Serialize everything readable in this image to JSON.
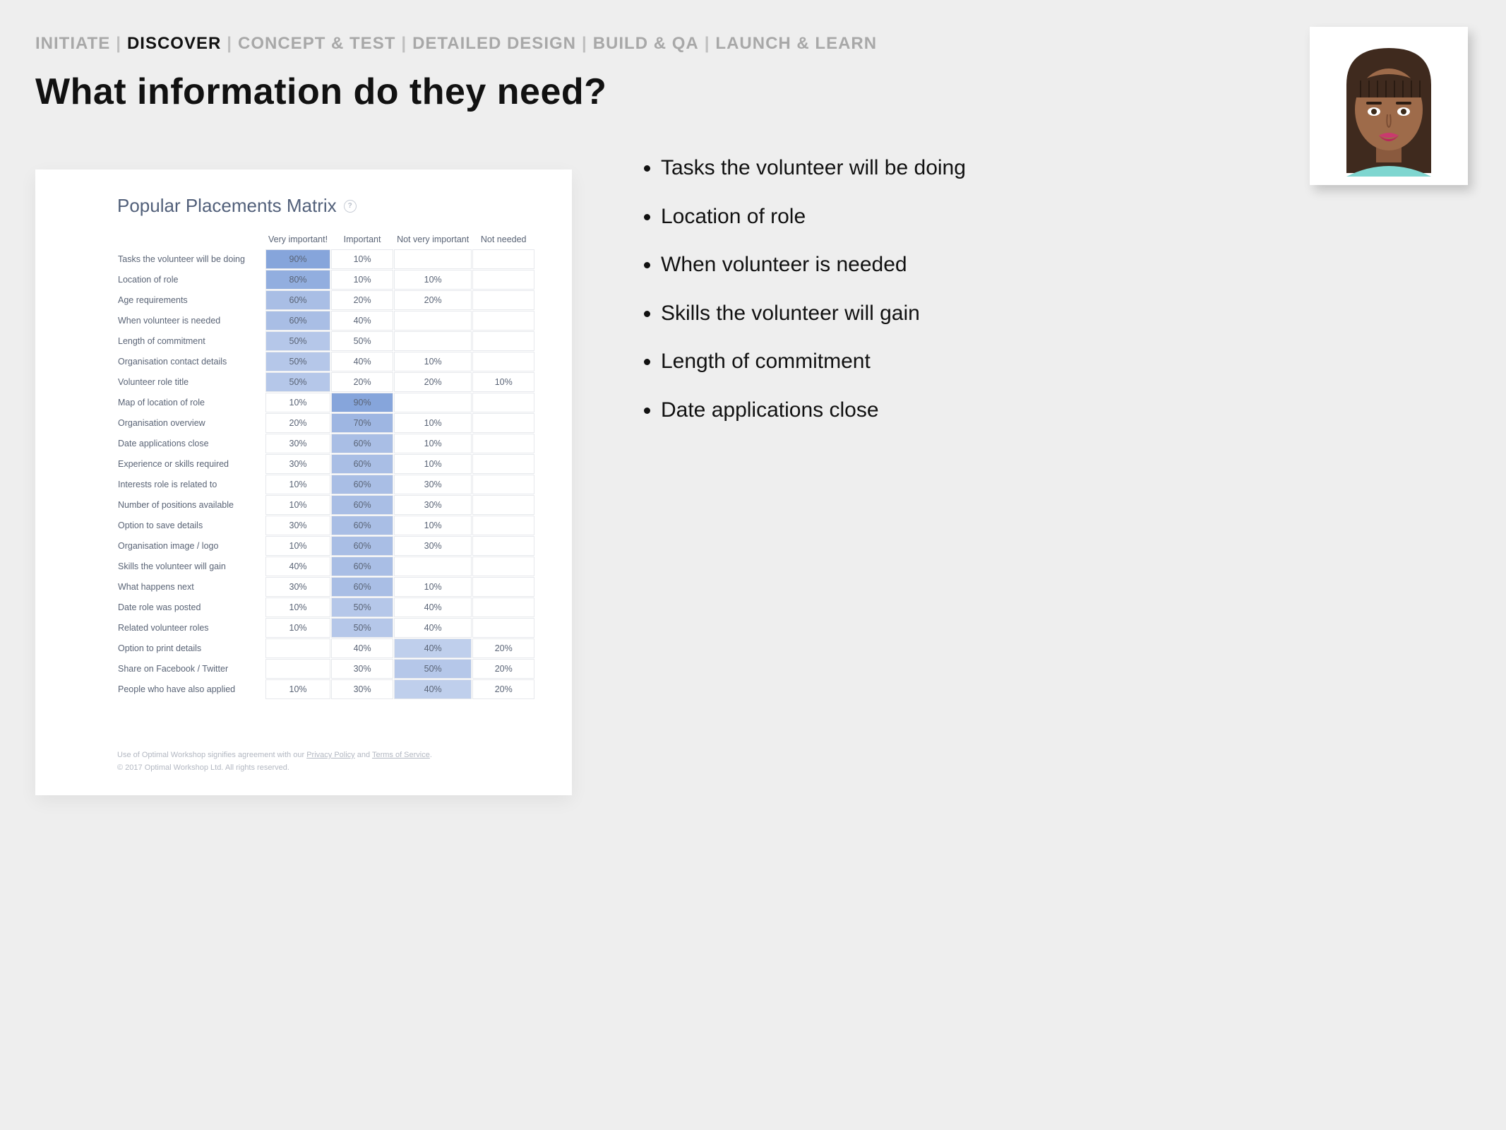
{
  "nav": {
    "items": [
      "INITIATE",
      "DISCOVER",
      "CONCEPT & TEST",
      "DETAILED DESIGN",
      "BUILD & QA",
      "LAUNCH & LEARN"
    ],
    "active_index": 1
  },
  "title": "What information do they need?",
  "matrix": {
    "title": "Popular Placements Matrix",
    "columns": [
      "Very important!",
      "Important",
      "Not very important",
      "Not needed"
    ],
    "rows": [
      {
        "label": "Tasks the volunteer will be doing",
        "cells": [
          "90%",
          "10%",
          "",
          ""
        ],
        "hi": 0
      },
      {
        "label": "Location of role",
        "cells": [
          "80%",
          "10%",
          "10%",
          ""
        ],
        "hi": 0
      },
      {
        "label": "Age requirements",
        "cells": [
          "60%",
          "20%",
          "20%",
          ""
        ],
        "hi": 0
      },
      {
        "label": "When volunteer is needed",
        "cells": [
          "60%",
          "40%",
          "",
          ""
        ],
        "hi": 0
      },
      {
        "label": "Length of commitment",
        "cells": [
          "50%",
          "50%",
          "",
          ""
        ],
        "hi": 0
      },
      {
        "label": "Organisation contact details",
        "cells": [
          "50%",
          "40%",
          "10%",
          ""
        ],
        "hi": 0
      },
      {
        "label": "Volunteer role title",
        "cells": [
          "50%",
          "20%",
          "20%",
          "10%"
        ],
        "hi": 0
      },
      {
        "label": "Map of location of role",
        "cells": [
          "10%",
          "90%",
          "",
          ""
        ],
        "hi": 1
      },
      {
        "label": "Organisation overview",
        "cells": [
          "20%",
          "70%",
          "10%",
          ""
        ],
        "hi": 1
      },
      {
        "label": "Date applications close",
        "cells": [
          "30%",
          "60%",
          "10%",
          ""
        ],
        "hi": 1
      },
      {
        "label": "Experience or skills required",
        "cells": [
          "30%",
          "60%",
          "10%",
          ""
        ],
        "hi": 1
      },
      {
        "label": "Interests role is related to",
        "cells": [
          "10%",
          "60%",
          "30%",
          ""
        ],
        "hi": 1
      },
      {
        "label": "Number of positions available",
        "cells": [
          "10%",
          "60%",
          "30%",
          ""
        ],
        "hi": 1
      },
      {
        "label": "Option to save details",
        "cells": [
          "30%",
          "60%",
          "10%",
          ""
        ],
        "hi": 1
      },
      {
        "label": "Organisation image / logo",
        "cells": [
          "10%",
          "60%",
          "30%",
          ""
        ],
        "hi": 1
      },
      {
        "label": "Skills the volunteer will gain",
        "cells": [
          "40%",
          "60%",
          "",
          ""
        ],
        "hi": 1
      },
      {
        "label": "What happens next",
        "cells": [
          "30%",
          "60%",
          "10%",
          ""
        ],
        "hi": 1
      },
      {
        "label": "Date role was posted",
        "cells": [
          "10%",
          "50%",
          "40%",
          ""
        ],
        "hi": 1
      },
      {
        "label": "Related volunteer roles",
        "cells": [
          "10%",
          "50%",
          "40%",
          ""
        ],
        "hi": 1
      },
      {
        "label": "Option to print details",
        "cells": [
          "",
          "40%",
          "40%",
          "20%"
        ],
        "hi": 2
      },
      {
        "label": "Share on Facebook / Twitter",
        "cells": [
          "",
          "30%",
          "50%",
          "20%"
        ],
        "hi": 2
      },
      {
        "label": "People who have also applied",
        "cells": [
          "10%",
          "30%",
          "40%",
          "20%"
        ],
        "hi": 2
      }
    ]
  },
  "footer": {
    "line1_pre": "Use of Optimal Workshop signifies agreement with our ",
    "privacy": "Privacy Policy",
    "and": " and ",
    "tos": "Terms of Service",
    "line1_post": ".",
    "line2": "© 2017 Optimal Workshop Ltd. All rights reserved."
  },
  "bullets": [
    "Tasks the volunteer will be doing",
    "Location of role",
    "When volunteer is needed",
    "Skills the volunteer will gain",
    "Length of commitment",
    "Date applications close"
  ],
  "chart_data": {
    "type": "table",
    "title": "Popular Placements Matrix",
    "columns": [
      "Very important!",
      "Important",
      "Not very important",
      "Not needed"
    ],
    "categories": [
      "Tasks the volunteer will be doing",
      "Location of role",
      "Age requirements",
      "When volunteer is needed",
      "Length of commitment",
      "Organisation contact details",
      "Volunteer role title",
      "Map of location of role",
      "Organisation overview",
      "Date applications close",
      "Experience or skills required",
      "Interests role is related to",
      "Number of positions available",
      "Option to save details",
      "Organisation image / logo",
      "Skills the volunteer will gain",
      "What happens next",
      "Date role was posted",
      "Related volunteer roles",
      "Option to print details",
      "Share on Facebook / Twitter",
      "People who have also applied"
    ],
    "series": [
      {
        "name": "Very important!",
        "values": [
          90,
          80,
          60,
          60,
          50,
          50,
          50,
          10,
          20,
          30,
          30,
          10,
          10,
          30,
          10,
          40,
          30,
          10,
          10,
          null,
          null,
          10
        ]
      },
      {
        "name": "Important",
        "values": [
          10,
          10,
          20,
          40,
          50,
          40,
          20,
          90,
          70,
          60,
          60,
          60,
          60,
          60,
          60,
          60,
          60,
          50,
          50,
          40,
          30,
          30
        ]
      },
      {
        "name": "Not very important",
        "values": [
          null,
          10,
          20,
          null,
          null,
          10,
          20,
          null,
          10,
          10,
          10,
          30,
          30,
          10,
          30,
          null,
          10,
          40,
          40,
          40,
          50,
          40
        ]
      },
      {
        "name": "Not needed",
        "values": [
          null,
          null,
          null,
          null,
          null,
          null,
          10,
          null,
          null,
          null,
          null,
          null,
          null,
          null,
          null,
          null,
          null,
          null,
          null,
          20,
          20,
          20
        ]
      }
    ],
    "unit": "percent"
  },
  "colors": {
    "heat_base": "#7c9dd8",
    "heat_min_alpha": 0.15,
    "heat_max_alpha": 1.0
  }
}
